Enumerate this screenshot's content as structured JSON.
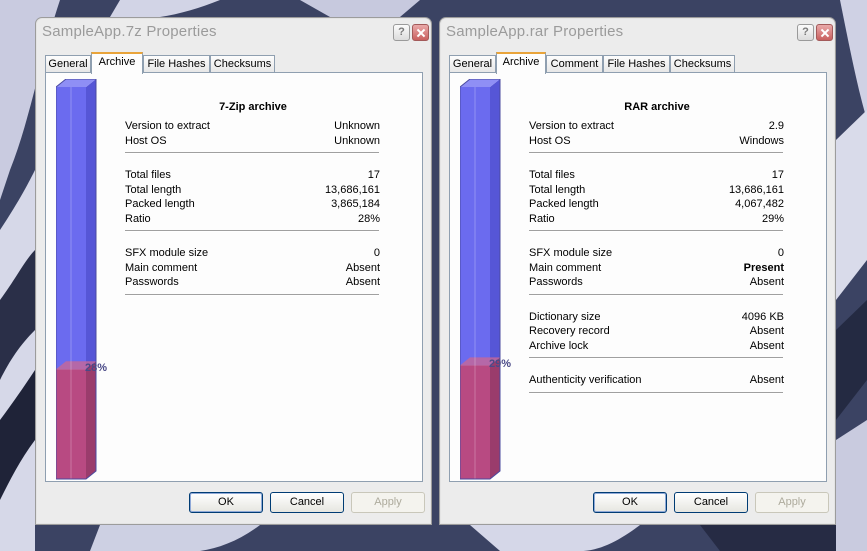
{
  "colors": {
    "gauge_free": "#6b6bef",
    "gauge_used": "#b84a82",
    "title_text": "#9b9b9b",
    "tab_highlight": "#e9a43a",
    "desktop_bg": "#3a4262"
  },
  "dialogs": [
    {
      "title": "SampleApp.7z Properties",
      "tabs": [
        "General",
        "Archive",
        "File Hashes",
        "Checksums"
      ],
      "active_tab": "Archive",
      "ratio_fraction": 0.28,
      "ratio_label": "28%",
      "archive_type": "7-Zip archive",
      "groups": [
        [
          {
            "label": "Version to extract",
            "value": "Unknown"
          },
          {
            "label": "Host OS",
            "value": "Unknown"
          }
        ],
        [
          {
            "label": "Total files",
            "value": "17"
          },
          {
            "label": "Total length",
            "value": "13,686,161"
          },
          {
            "label": "Packed length",
            "value": "3,865,184"
          },
          {
            "label": "Ratio",
            "value": "28%"
          }
        ],
        [
          {
            "label": "SFX module size",
            "value": "0"
          },
          {
            "label": "Main comment",
            "value": "Absent"
          },
          {
            "label": "Passwords",
            "value": "Absent"
          }
        ]
      ],
      "buttons": {
        "ok": "OK",
        "cancel": "Cancel",
        "apply": "Apply"
      }
    },
    {
      "title": "SampleApp.rar Properties",
      "tabs": [
        "General",
        "Archive",
        "Comment",
        "File Hashes",
        "Checksums"
      ],
      "active_tab": "Archive",
      "ratio_fraction": 0.29,
      "ratio_label": "29%",
      "archive_type": "RAR archive",
      "groups": [
        [
          {
            "label": "Version to extract",
            "value": "2.9"
          },
          {
            "label": "Host OS",
            "value": "Windows"
          }
        ],
        [
          {
            "label": "Total files",
            "value": "17"
          },
          {
            "label": "Total length",
            "value": "13,686,161"
          },
          {
            "label": "Packed length",
            "value": "4,067,482"
          },
          {
            "label": "Ratio",
            "value": "29%"
          }
        ],
        [
          {
            "label": "SFX module size",
            "value": "0"
          },
          {
            "label": "Main comment",
            "value": "Present",
            "bold": true
          },
          {
            "label": "Passwords",
            "value": "Absent"
          }
        ],
        [
          {
            "label": "Dictionary size",
            "value": "4096 KB"
          },
          {
            "label": "Recovery record",
            "value": "Absent"
          },
          {
            "label": "Archive lock",
            "value": "Absent"
          }
        ],
        [
          {
            "label": "Authenticity verification",
            "value": "Absent"
          }
        ]
      ],
      "buttons": {
        "ok": "OK",
        "cancel": "Cancel",
        "apply": "Apply"
      }
    }
  ]
}
